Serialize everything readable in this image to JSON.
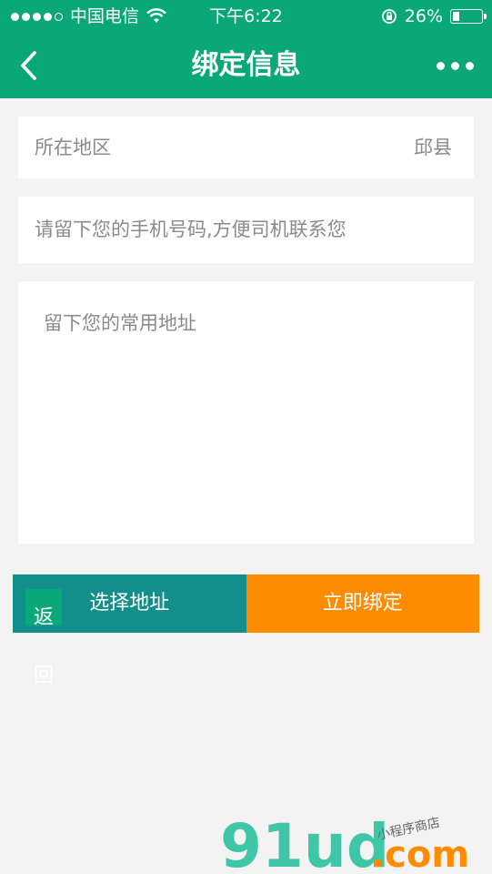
{
  "status": {
    "carrier": "中国电信",
    "time": "下午6:22",
    "battery": "26%",
    "battery_level": 0.26,
    "icons": [
      "signal-dots-icon",
      "wifi-icon",
      "rotation-lock-icon",
      "battery-icon"
    ]
  },
  "nav": {
    "title": "绑定信息",
    "back_icon": "chevron-left-icon",
    "more_icon": "more-dots-icon"
  },
  "form": {
    "region_label": "所在地区",
    "region_value": "邱县",
    "phone_placeholder": "请留下您的手机号码,方便司机联系您",
    "address_placeholder": "留下您的常用地址"
  },
  "buttons": {
    "select_address": "选择地址",
    "bind_now": "立即绑定",
    "back": "返回"
  },
  "watermark": {
    "brand": "91ud",
    "domain": ".com",
    "tagline": "小程序商店"
  },
  "colors": {
    "primary": "#0aa778",
    "teal": "#128f8b",
    "orange": "#ff8c00"
  }
}
